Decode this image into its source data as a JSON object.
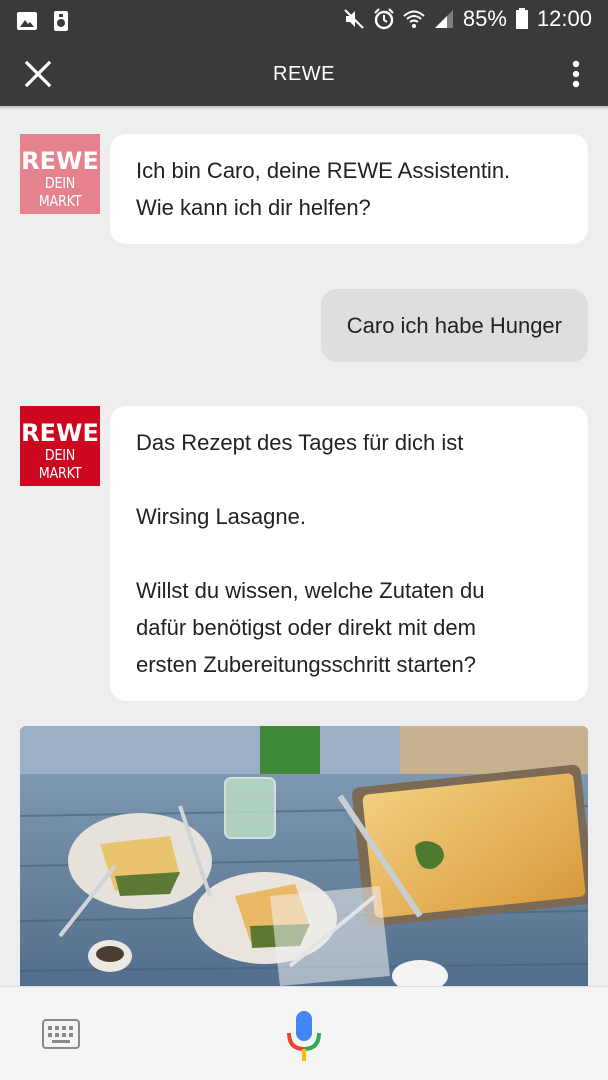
{
  "status_bar": {
    "battery": "85%",
    "time": "12:00",
    "icons": [
      "image-icon",
      "storage-icon",
      "mute-icon",
      "alarm-icon",
      "wifi-icon",
      "signal-icon",
      "battery-icon"
    ]
  },
  "app_bar": {
    "title": "REWE",
    "left_icon": "close-icon",
    "right_icon": "more-vert-icon"
  },
  "brand": {
    "logo_top": "REWE",
    "logo_bottom": "DEIN MARKT",
    "colors": {
      "rewe_red": "#cc071e",
      "rewe_faded": "#e6828e"
    }
  },
  "messages": [
    {
      "from": "bot",
      "lines": [
        "Ich bin Caro, deine REWE Assistentin.",
        "Wie kann ich dir helfen?"
      ]
    },
    {
      "from": "user",
      "lines": [
        "Caro ich habe Hunger"
      ]
    },
    {
      "from": "bot",
      "lines": [
        "Das Rezept des Tages für dich ist",
        "",
        "Wirsing Lasagne.",
        "",
        "Willst du wissen, welche Zutaten du",
        "dafür benötigst oder direkt mit dem",
        "ersten Zubereitungsschritt starten?"
      ]
    }
  ],
  "bottom_bar": {
    "left_icon": "keyboard-icon",
    "center_icon": "mic-icon"
  }
}
